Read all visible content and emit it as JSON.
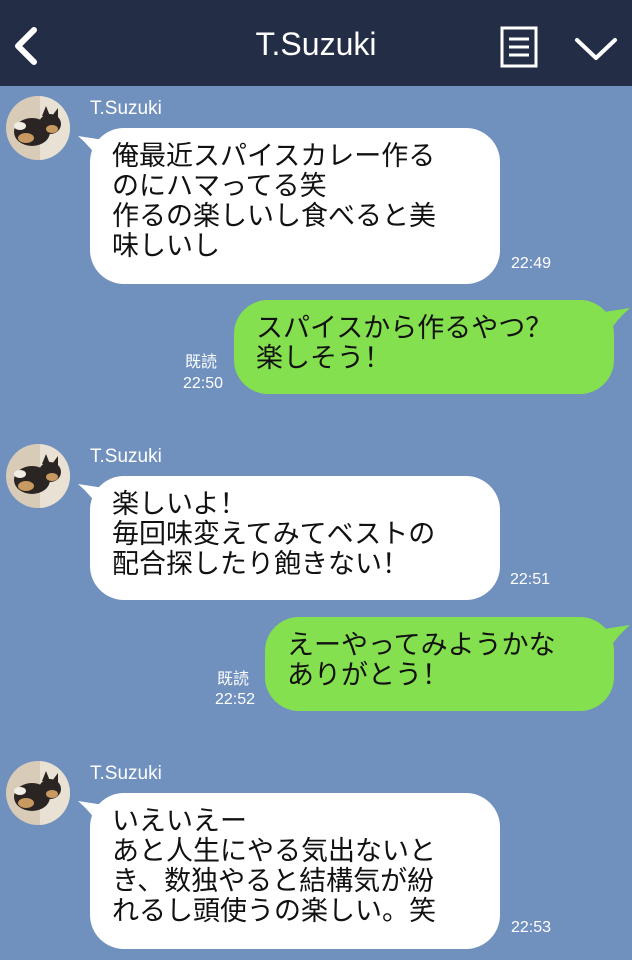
{
  "header": {
    "title": "T.Suzuki",
    "back_icon": "chevron-left-icon",
    "menu_icon": "notes-icon",
    "more_icon": "chevron-down-icon",
    "background": "#232d45"
  },
  "chat": {
    "background": "#7090bd",
    "incoming_bubble_color": "#ffffff",
    "outgoing_bubble_color": "#84e04e",
    "messages": [
      {
        "direction": "in",
        "sender": "T.Suzuki",
        "text": "俺最近スパイスカレー作る\nのにハマってる笑\n作るの楽しいし食べると美\n味しいし",
        "time": "22:49"
      },
      {
        "direction": "out",
        "read": "既読",
        "text": "スパイスから作るやつ？\n楽しそう！",
        "time": "22:50"
      },
      {
        "direction": "in",
        "sender": "T.Suzuki",
        "text": "楽しいよ！\n毎回味変えてみてベストの\n配合探したり飽きない！",
        "time": "22:51"
      },
      {
        "direction": "out",
        "read": "既読",
        "text": "えーやってみようかな\nありがとう！",
        "time": "22:52"
      },
      {
        "direction": "in",
        "sender": "T.Suzuki",
        "text": "いえいえー\nあと人生にやる気出ないと\nき、数独やると結構気が紛\nれるし頭使うの楽しい。笑",
        "time": "22:53"
      }
    ]
  }
}
